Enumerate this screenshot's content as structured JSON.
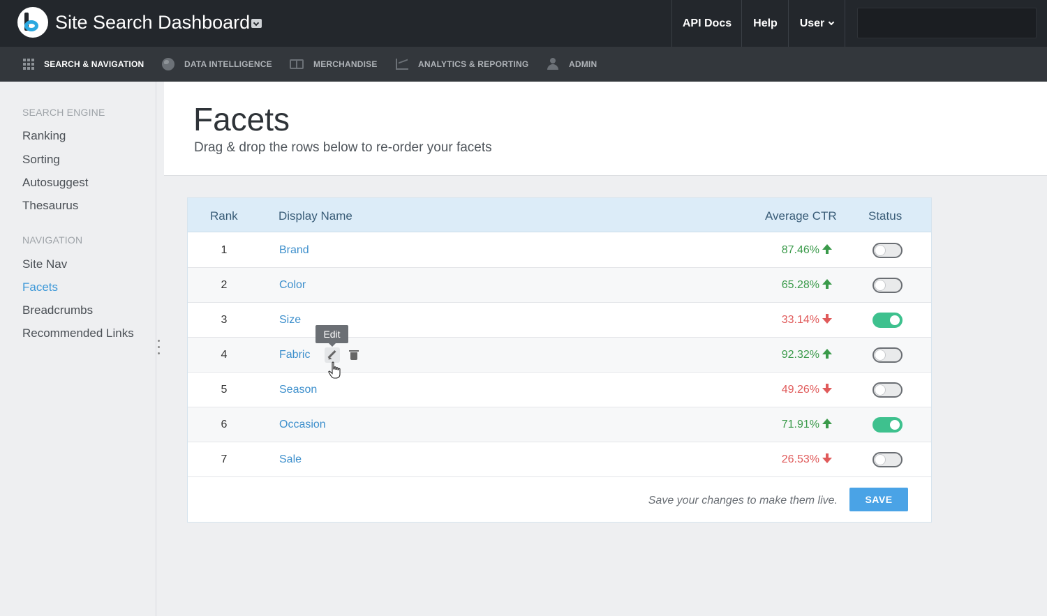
{
  "app": {
    "title": "Site Search Dashboard"
  },
  "topnav": {
    "api_docs": "API Docs",
    "help": "Help",
    "user": "User",
    "search_value": ""
  },
  "subnav": {
    "items": [
      {
        "label": "SEARCH & NAVIGATION",
        "icon": "grid-icon",
        "active": true
      },
      {
        "label": "DATA INTELLIGENCE",
        "icon": "globe-icon",
        "active": false
      },
      {
        "label": "MERCHANDISE",
        "icon": "book-icon",
        "active": false
      },
      {
        "label": "ANALYTICS & REPORTING",
        "icon": "chart-icon",
        "active": false
      },
      {
        "label": "ADMIN",
        "icon": "person-icon",
        "active": false
      }
    ]
  },
  "sidebar": {
    "search_engine_heading": "SEARCH ENGINE",
    "search_engine_items": [
      "Ranking",
      "Sorting",
      "Autosuggest",
      "Thesaurus"
    ],
    "navigation_heading": "NAVIGATION",
    "navigation_items": [
      "Site Nav",
      "Facets",
      "Breadcrumbs",
      "Recommended Links"
    ],
    "active_item": "Facets"
  },
  "page": {
    "title": "Facets",
    "subtitle": "Drag & drop the rows below to re-order your facets"
  },
  "table": {
    "columns": {
      "rank": "Rank",
      "display_name": "Display Name",
      "average_ctr": "Average CTR",
      "status": "Status"
    },
    "rows": [
      {
        "rank": "1",
        "name": "Brand",
        "ctr": "87.46%",
        "trend": "up",
        "enabled": false
      },
      {
        "rank": "2",
        "name": "Color",
        "ctr": "65.28%",
        "trend": "up",
        "enabled": false
      },
      {
        "rank": "3",
        "name": "Size",
        "ctr": "33.14%",
        "trend": "down",
        "enabled": true
      },
      {
        "rank": "4",
        "name": "Fabric",
        "ctr": "92.32%",
        "trend": "up",
        "enabled": false
      },
      {
        "rank": "5",
        "name": "Season",
        "ctr": "49.26%",
        "trend": "down",
        "enabled": false
      },
      {
        "rank": "6",
        "name": "Occasion",
        "ctr": "71.91%",
        "trend": "up",
        "enabled": true
      },
      {
        "rank": "7",
        "name": "Sale",
        "ctr": "26.53%",
        "trend": "down",
        "enabled": false
      }
    ],
    "tooltip": "Edit",
    "footer_note": "Save your changes to make them live.",
    "save_label": "SAVE"
  },
  "colors": {
    "accent": "#3d98d8",
    "trend_up": "#3a9a4a",
    "trend_down": "#e05a5a",
    "toggle_on": "#3ec18e"
  }
}
